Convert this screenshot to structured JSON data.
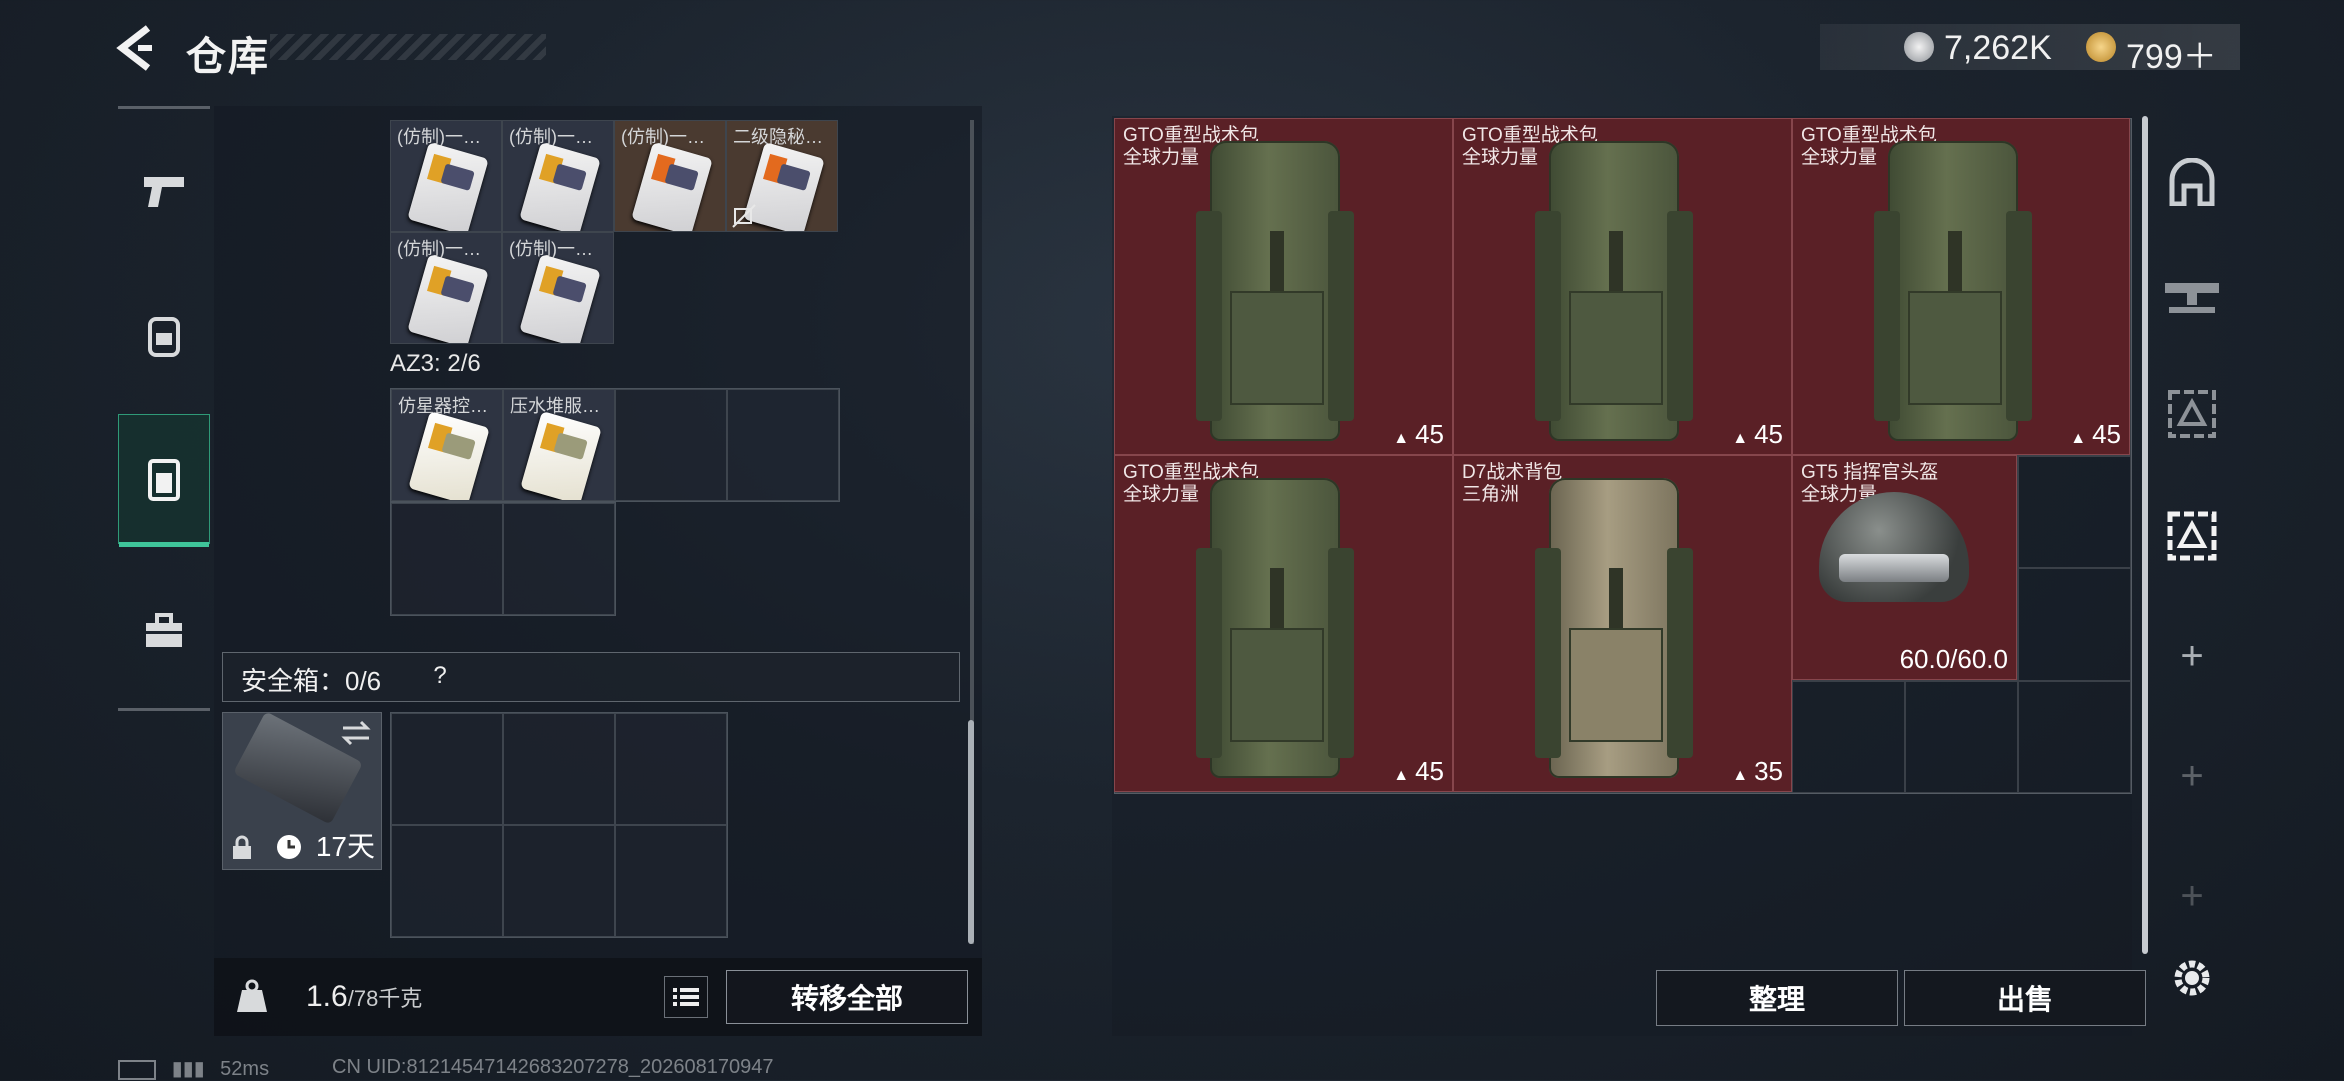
{
  "header": {
    "title": "仓库",
    "currency": [
      {
        "icon": "silver-coin-icon",
        "value": "7,262K"
      },
      {
        "icon": "gold-coin-icon",
        "value": "799＋"
      }
    ]
  },
  "left_rail": [
    "pistol-icon",
    "backpack-icon",
    "rig-icon",
    "briefcase-icon"
  ],
  "container1": {
    "items": [
      {
        "name": "(仿制)一…",
        "type": "yellow"
      },
      {
        "name": "(仿制)一…",
        "type": "yellow"
      },
      {
        "name": "(仿制)一…",
        "type": "orange"
      },
      {
        "name": "二级隐秘…",
        "type": "orange"
      },
      {
        "name": "(仿制)一…",
        "type": "yellow"
      },
      {
        "name": "(仿制)一…",
        "type": "yellow"
      }
    ]
  },
  "container2": {
    "label": "AZ3: 2/6",
    "items": [
      {
        "name": "仿星器控…"
      },
      {
        "name": "压水堆服…"
      }
    ]
  },
  "safe_box": {
    "label": "安全箱：0/6",
    "help": "?",
    "days": "17天"
  },
  "bottom_left": {
    "weight": "1.6",
    "capacity": "/78千克",
    "transfer_all": "转移全部"
  },
  "stash": [
    {
      "name": "GTO重型战术包",
      "sub": "全球力量",
      "capacity": "45",
      "style": "green"
    },
    {
      "name": "GTO重型战术包",
      "sub": "全球力量",
      "capacity": "45",
      "style": "green"
    },
    {
      "name": "GTO重型战术包",
      "sub": "全球力量",
      "capacity": "45",
      "style": "green"
    },
    {
      "name": "GTO重型战术包",
      "sub": "全球力量",
      "capacity": "45",
      "style": "green"
    },
    {
      "name": "D7战术背包",
      "sub": "三角洲",
      "capacity": "35",
      "style": "tan"
    },
    {
      "name": "GT5 指挥官头盔",
      "sub": "全球力量",
      "durability": "60.0/60.0",
      "style": "helmet"
    }
  ],
  "actions": {
    "sort": "整理",
    "sell": "出售"
  },
  "right_rail": [
    "armor-icon",
    "rifle-icon",
    "tactical-icon",
    "selected-tactical-icon",
    "add-icon",
    "add-icon",
    "add-icon",
    "gear-icon"
  ],
  "status": {
    "ping": "52ms",
    "uid": "CN UID:81214547142683207278_202608170947"
  }
}
